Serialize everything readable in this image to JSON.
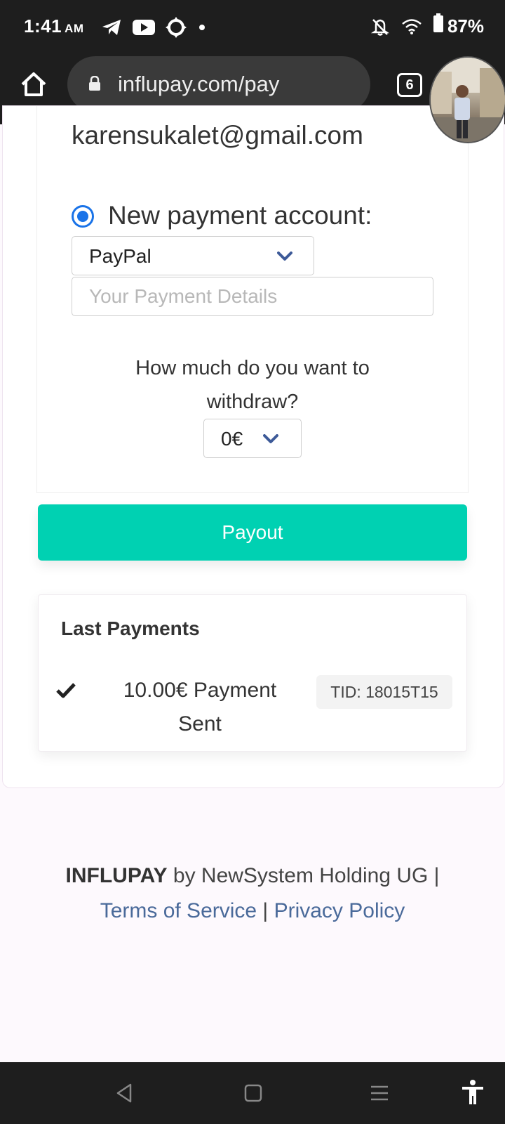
{
  "status_bar": {
    "time": "1:41",
    "ampm": "AM",
    "battery": "87%",
    "icons": [
      "telegram-icon",
      "youtube-icon",
      "sync-icon",
      "dot-icon",
      "bell-off-icon",
      "wifi-icon",
      "battery-icon"
    ]
  },
  "browser": {
    "url": "influpay.com/pay",
    "tab_count": "6"
  },
  "form": {
    "email": "karensukalet@gmail.com",
    "new_account_label": "New payment account:",
    "method_selected": "PayPal",
    "details_placeholder": "Your Payment Details",
    "question": "How much do you want to withdraw?",
    "amount_selected": "0€"
  },
  "payout_label": "Payout",
  "last_payments": {
    "title": "Last Payments",
    "items": [
      {
        "text": "10.00€ Payment Sent",
        "tid": "TID: 18015T15"
      }
    ]
  },
  "footer": {
    "brand": "INFLUPAY",
    "by_text": " by NewSystem Holding UG |",
    "terms": "Terms of Service",
    "separator": " | ",
    "privacy": "Privacy Policy"
  },
  "colors": {
    "accent": "#00d1b2",
    "radio": "#1a73e8",
    "link": "#4a6a9a",
    "chrome_bg": "#1e1e1e"
  }
}
